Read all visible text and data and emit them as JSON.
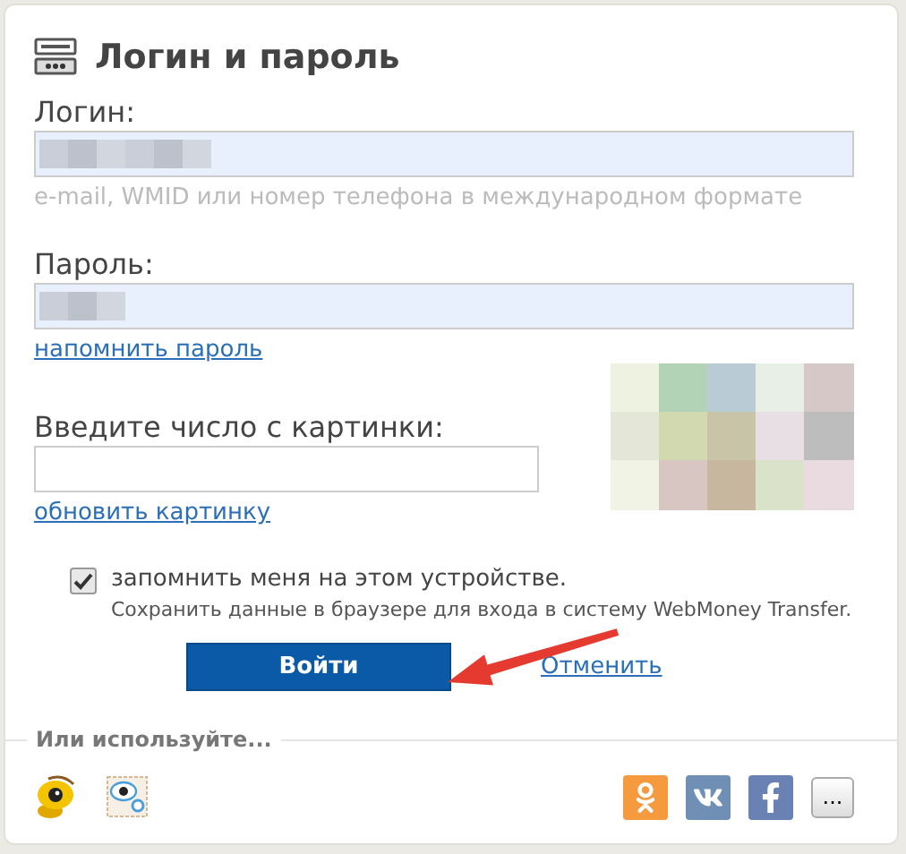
{
  "title": "Логин и пароль",
  "login": {
    "label": "Логин:",
    "hint": "e-mail, WMID или номер телефона в международном формате",
    "filled": true
  },
  "password": {
    "label": "Пароль:",
    "filled": true,
    "link": "напомнить пароль"
  },
  "captcha": {
    "label": "Введите число с картинки:",
    "link": "обновить картинку"
  },
  "remember": {
    "checked": true,
    "label": "запомнить меня на этом устройстве.",
    "note": "Сохранить данные в браузере для входа в систему WebMoney Transfer."
  },
  "submit": "Войти",
  "cancel": "Отменить",
  "alternatives": {
    "heading": "Или используйте...",
    "more": "..."
  },
  "annotation": {
    "kind": "arrow"
  }
}
